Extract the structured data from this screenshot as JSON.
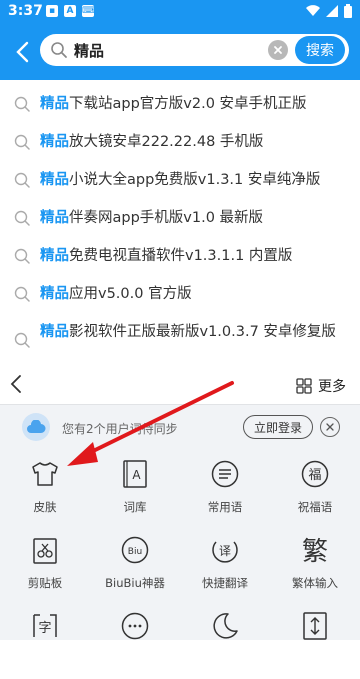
{
  "status_bar": {
    "time": "3:37",
    "icons": [
      "sim-icon",
      "a-icon",
      "keyboard-icon"
    ]
  },
  "header": {
    "back_label": "back",
    "search_value": "精品",
    "search_button": "搜索"
  },
  "results": {
    "keyword": "精品",
    "items": [
      {
        "keyword": "精品",
        "rest": "下载站app官方版v2.0 安卓手机正版"
      },
      {
        "keyword": "精品",
        "rest": "放大镜安卓222.22.48 手机版"
      },
      {
        "keyword": "精品",
        "rest": "小说大全app免费版v1.3.1 安卓纯净版"
      },
      {
        "keyword": "精品",
        "rest": "伴奏网app手机版v1.0 最新版"
      },
      {
        "keyword": "精品",
        "rest": "免费电视直播软件v1.3.1.1 内置版"
      },
      {
        "keyword": "精品",
        "rest": "应用v5.0.0 官方版"
      },
      {
        "keyword": "精品",
        "rest": "影视软件正版最新版v1.0.3.7 安卓修复版"
      }
    ]
  },
  "keyboard_nav": {
    "more_label": "更多"
  },
  "sync": {
    "text": "您有2个用户词待同步",
    "login_label": "立即登录"
  },
  "grid": {
    "items": [
      {
        "label": "皮肤",
        "icon": "tshirt-icon"
      },
      {
        "label": "词库",
        "icon": "dictionary-icon"
      },
      {
        "label": "常用语",
        "icon": "chat-icon"
      },
      {
        "label": "祝福语",
        "icon": "blessing-icon"
      },
      {
        "label": "剪贴板",
        "icon": "clipboard-icon"
      },
      {
        "label": "BiuBiu神器",
        "icon": "biu-icon"
      },
      {
        "label": "快捷翻译",
        "icon": "translate-icon"
      },
      {
        "label": "繁体输入",
        "icon": "traditional-icon"
      },
      {
        "label": "",
        "icon": "text-icon"
      },
      {
        "label": "",
        "icon": "emoji-chat-icon"
      },
      {
        "label": "",
        "icon": "moon-icon"
      },
      {
        "label": "",
        "icon": "resize-icon"
      }
    ],
    "icon_glyphs": {
      "dictionary": "A",
      "blessing": "福",
      "biu": "Biu",
      "translate": "译",
      "traditional": "繁",
      "text": "字"
    }
  },
  "colors": {
    "brand": "#1a96f2",
    "arrow": "#e0191c",
    "panel": "#f1f3f6"
  }
}
